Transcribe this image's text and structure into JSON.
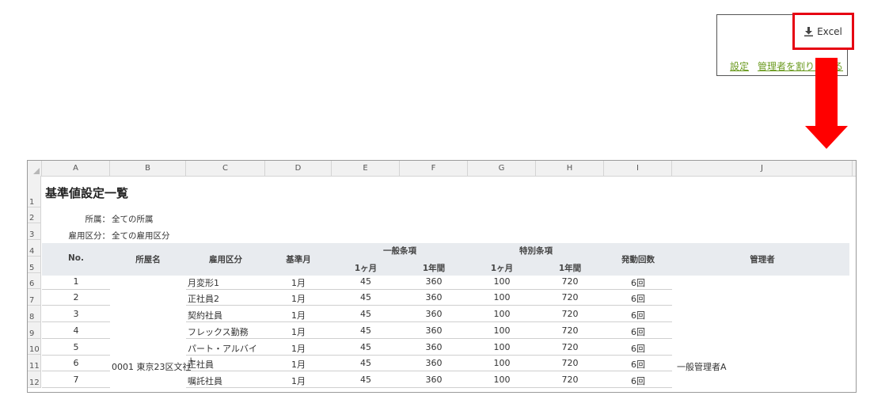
{
  "popup": {
    "excel_label": "Excel",
    "link_settings": "設定",
    "link_admin": "管理者を割り当てる"
  },
  "sheet": {
    "columns": [
      "A",
      "B",
      "C",
      "D",
      "E",
      "F",
      "G",
      "H",
      "I",
      "J"
    ],
    "rows": [
      "1",
      "2",
      "3",
      "4",
      "5",
      "6",
      "7",
      "8",
      "9",
      "10",
      "11",
      "12"
    ],
    "title": "基準値設定一覧",
    "dept_label": "所属：",
    "dept_value": "全ての所属",
    "emp_label": "雇用区分：",
    "emp_value": "全ての雇用区分",
    "headers": {
      "no": "No.",
      "dept_name": "所屋名",
      "emp_type": "雇用区分",
      "base_month": "基準月",
      "general": "一般条項",
      "special": "特別条項",
      "g_month": "1ヶ月",
      "g_year": "1年間",
      "s_month": "1ヶ月",
      "s_year": "1年間",
      "count": "発動回数",
      "admin": "管理者"
    },
    "dept_merged": "0001 東京23区文社",
    "admin_merged": "一般管理者A",
    "data": [
      {
        "no": "1",
        "type": "月変形1",
        "month": "1月",
        "g1": "45",
        "g2": "360",
        "s1": "100",
        "s2": "720",
        "count": "6回"
      },
      {
        "no": "2",
        "type": "正社員2",
        "month": "1月",
        "g1": "45",
        "g2": "360",
        "s1": "100",
        "s2": "720",
        "count": "6回"
      },
      {
        "no": "3",
        "type": "契約社員",
        "month": "1月",
        "g1": "45",
        "g2": "360",
        "s1": "100",
        "s2": "720",
        "count": "6回"
      },
      {
        "no": "4",
        "type": "フレックス勤務",
        "month": "1月",
        "g1": "45",
        "g2": "360",
        "s1": "100",
        "s2": "720",
        "count": "6回"
      },
      {
        "no": "5",
        "type": "パート・アルバイト",
        "month": "1月",
        "g1": "45",
        "g2": "360",
        "s1": "100",
        "s2": "720",
        "count": "6回"
      },
      {
        "no": "6",
        "type": "正社員",
        "month": "1月",
        "g1": "45",
        "g2": "360",
        "s1": "100",
        "s2": "720",
        "count": "6回"
      },
      {
        "no": "7",
        "type": "嘱託社員",
        "month": "1月",
        "g1": "45",
        "g2": "360",
        "s1": "100",
        "s2": "720",
        "count": "6回"
      }
    ]
  }
}
